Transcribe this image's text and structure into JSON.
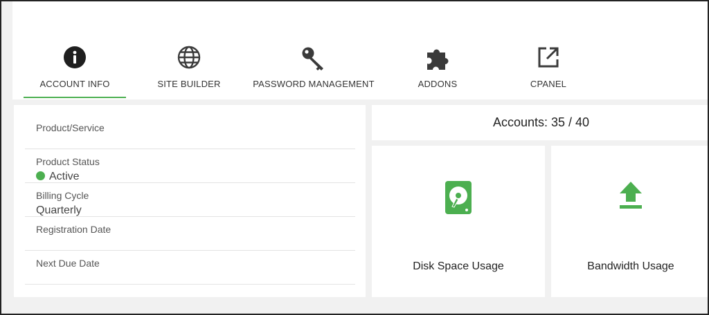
{
  "tabs": [
    {
      "label": "ACCOUNT INFO",
      "icon": "info-circle-icon",
      "active": true
    },
    {
      "label": "SITE BUILDER",
      "icon": "globe-icon"
    },
    {
      "label": "PASSWORD MANAGEMENT",
      "icon": "key-icon"
    },
    {
      "label": "ADDONS",
      "icon": "puzzle-icon"
    },
    {
      "label": "CPANEL",
      "icon": "external-link-icon"
    }
  ],
  "details": {
    "product_label": "Product/Service",
    "product_value": "",
    "status_label": "Product Status",
    "status_value": "Active",
    "billing_label": "Billing Cycle",
    "billing_value": "Quarterly",
    "registration_label": "Registration Date",
    "registration_value": "",
    "due_label": "Next Due Date",
    "due_value": ""
  },
  "accounts": {
    "text": "Accounts: 35 / 40"
  },
  "cards": {
    "disk_label": "Disk Space Usage",
    "disk_icon": "hard-drive-icon",
    "bandwidth_label": "Bandwidth Usage",
    "bandwidth_icon": "upload-icon"
  },
  "colors": {
    "accent": "#4caf50",
    "icon_dark": "#3a3a3a",
    "background": "#f1f1f1"
  }
}
